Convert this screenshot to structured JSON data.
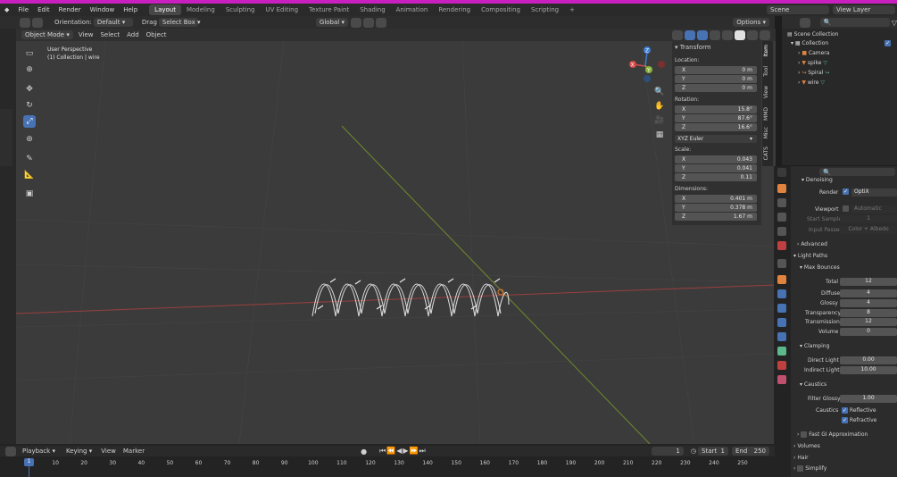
{
  "menu": {
    "items": [
      "File",
      "Edit",
      "Render",
      "Window",
      "Help"
    ],
    "workspaces": [
      "Layout",
      "Modeling",
      "Sculpting",
      "UV Editing",
      "Texture Paint",
      "Shading",
      "Animation",
      "Rendering",
      "Compositing",
      "Scripting"
    ],
    "active_workspace": "Layout",
    "add_tab": "+",
    "scene_label": "Scene",
    "view_layer_label": "View Layer"
  },
  "toolbar": {
    "orientation_label": "Orientation:",
    "orientation_value": "Default",
    "drag_label": "Drag",
    "drag_value": "Select Box",
    "transform_orientation": "Global",
    "options_label": "Options"
  },
  "viewport_header": {
    "mode": "Object Mode",
    "menus": [
      "View",
      "Select",
      "Add",
      "Object"
    ]
  },
  "viewport": {
    "perspective": "User Perspective",
    "collection_info": "(1) Collection | wire",
    "gizmo": {
      "x": "X",
      "y": "Y",
      "z": "Z"
    },
    "colors": {
      "x_axis": "#d44a4a",
      "y_axis": "#8ab23a",
      "z_axis": "#3d7fd4"
    }
  },
  "transform_panel": {
    "title": "Transform",
    "location_label": "Location:",
    "location": [
      {
        "axis": "X",
        "value": "0 m"
      },
      {
        "axis": "Y",
        "value": "0 m"
      },
      {
        "axis": "Z",
        "value": "0 m"
      }
    ],
    "rotation_label": "Rotation:",
    "rotation": [
      {
        "axis": "X",
        "value": "15.8°"
      },
      {
        "axis": "Y",
        "value": "87.6°"
      },
      {
        "axis": "Z",
        "value": "16.6°"
      }
    ],
    "rotation_mode": "XYZ Euler",
    "scale_label": "Scale:",
    "scale": [
      {
        "axis": "X",
        "value": "0.043"
      },
      {
        "axis": "Y",
        "value": "0.041"
      },
      {
        "axis": "Z",
        "value": "0.11"
      }
    ],
    "dimensions_label": "Dimensions:",
    "dimensions": [
      {
        "axis": "X",
        "value": "0.401 m"
      },
      {
        "axis": "Y",
        "value": "0.378 m"
      },
      {
        "axis": "Z",
        "value": "1.67 m"
      }
    ]
  },
  "side_tabs": [
    "Item",
    "Tool",
    "View",
    "MMD",
    "Misc",
    "CATS"
  ],
  "outliner": {
    "scene_collection": "Scene Collection",
    "collection": "Collection",
    "objects": [
      "Camera",
      "spike",
      "Spiral",
      "wire"
    ]
  },
  "properties": {
    "denoising": "Denoising",
    "render_label": "Render",
    "render_value": "OptiX",
    "viewport_label": "Viewport",
    "viewport_value": "Automatic",
    "start_sample_label": "Start Sample",
    "start_sample_value": "1",
    "input_passes_label": "Input Passes",
    "input_passes_value": "Color + Albedo",
    "advanced": "Advanced",
    "light_paths": "Light Paths",
    "max_bounces": "Max Bounces",
    "bounces": [
      {
        "label": "Total",
        "value": "12"
      },
      {
        "label": "Diffuse",
        "value": "4"
      },
      {
        "label": "Glossy",
        "value": "4"
      },
      {
        "label": "Transparency",
        "value": "8"
      },
      {
        "label": "Transmission",
        "value": "12"
      },
      {
        "label": "Volume",
        "value": "0"
      }
    ],
    "clamping": "Clamping",
    "direct_light_label": "Direct Light",
    "direct_light_value": "0.00",
    "indirect_light_label": "Indirect Light",
    "indirect_light_value": "10.00",
    "caustics": "Caustics",
    "filter_glossy_label": "Filter Glossy",
    "filter_glossy_value": "1.00",
    "caustics_label": "Caustics",
    "reflective": "Reflective",
    "refractive": "Refractive",
    "fast_gi": "Fast GI Approximation",
    "volumes": "Volumes",
    "hair": "Hair",
    "simplify": "Simplify"
  },
  "timeline": {
    "menus": [
      "Playback",
      "Keying",
      "View",
      "Marker"
    ],
    "current_frame": "1",
    "start_label": "Start",
    "start_value": "1",
    "end_label": "End",
    "end_value": "250",
    "ticks": [
      "0",
      "10",
      "20",
      "30",
      "40",
      "50",
      "60",
      "70",
      "80",
      "90",
      "100",
      "110",
      "120",
      "130",
      "140",
      "150",
      "160",
      "170",
      "180",
      "190",
      "200",
      "210",
      "220",
      "230",
      "240",
      "250"
    ],
    "playhead_frame": "1"
  },
  "colors": {
    "accent": "#4772b3",
    "topbar": "#c91fc0"
  }
}
